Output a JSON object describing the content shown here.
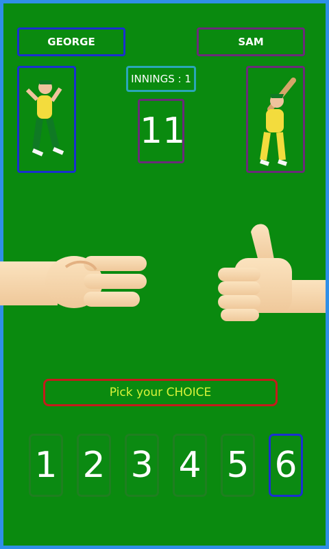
{
  "players": {
    "left": {
      "name": "GEORGE",
      "role": "bowler"
    },
    "right": {
      "name": "SAM",
      "role": "batsman"
    }
  },
  "innings": "INNINGS : 1",
  "score": "11",
  "status": "Pick your CHOICE",
  "choices": [
    {
      "label": "1",
      "selected": false
    },
    {
      "label": "2",
      "selected": false
    },
    {
      "label": "3",
      "selected": false
    },
    {
      "label": "4",
      "selected": false
    },
    {
      "label": "5",
      "selected": false
    },
    {
      "label": "6",
      "selected": true
    }
  ],
  "hands": {
    "left": {
      "icon": "three-fingers-hand-icon",
      "value": 3
    },
    "right": {
      "icon": "thumbs-up-hand-icon",
      "value": 6
    }
  },
  "colors": {
    "background_frame": "#2f8fe8",
    "field": "#0a8a0f",
    "selected_border": "#1b2fd1",
    "status_text": "#d8f33a"
  }
}
